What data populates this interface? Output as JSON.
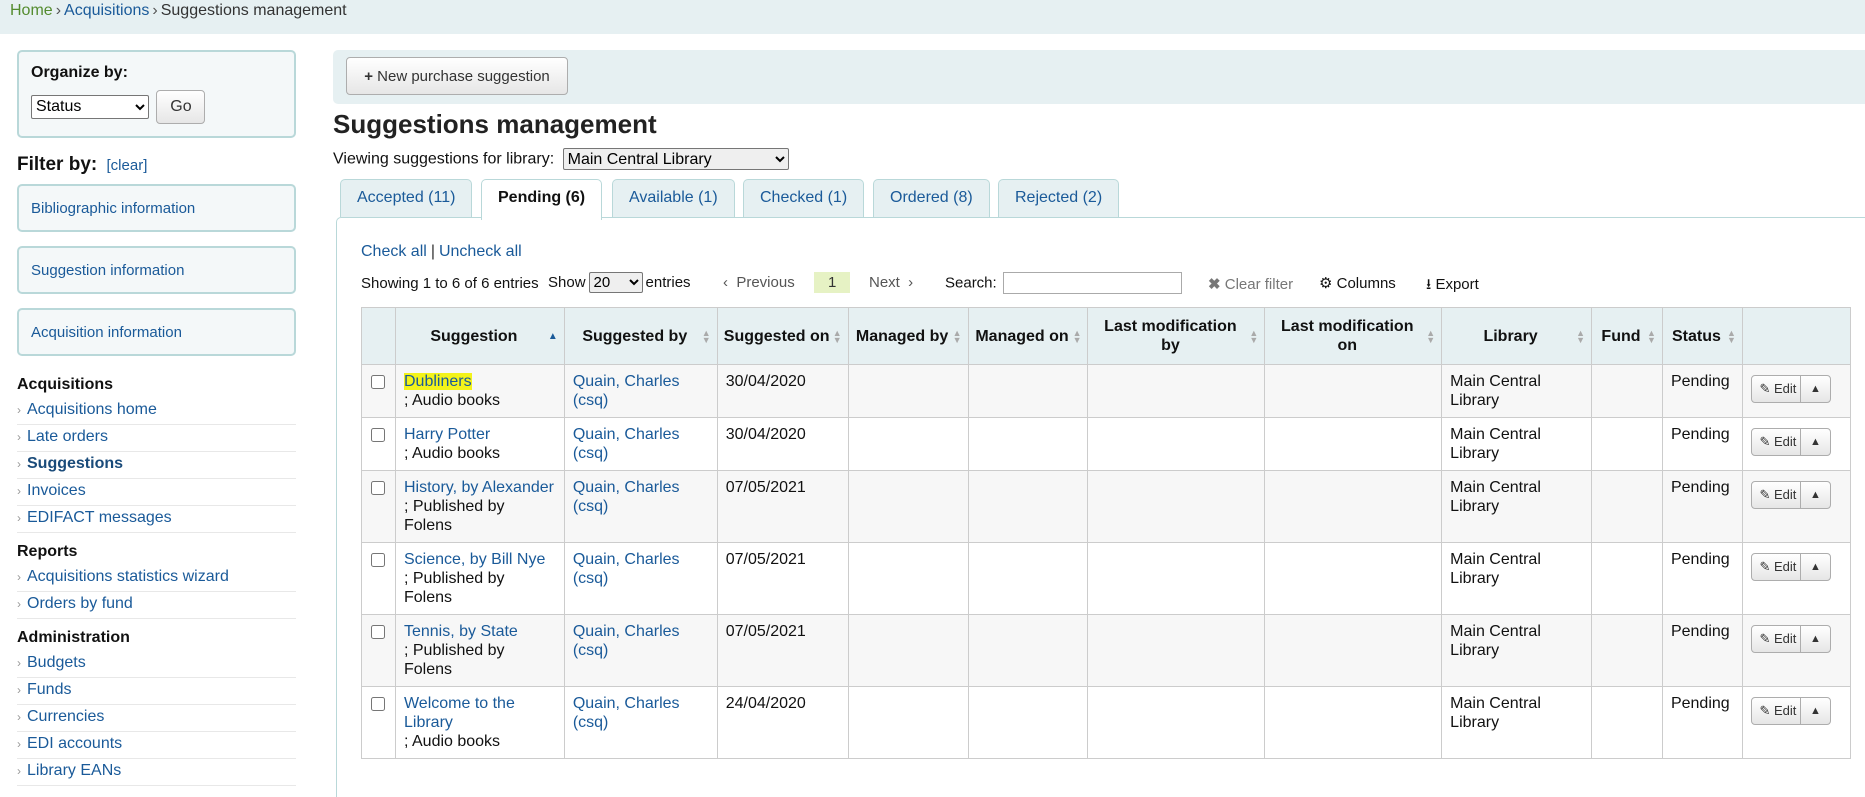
{
  "breadcrumb": {
    "home": "Home",
    "acquisitions": "Acquisitions",
    "current": "Suggestions management",
    "separator": "›"
  },
  "organize": {
    "label": "Organize by:",
    "selected": "Status",
    "go_label": "Go"
  },
  "filter": {
    "label": "Filter by:",
    "clear": "[clear]",
    "sections": [
      "Bibliographic information",
      "Suggestion information",
      "Acquisition information"
    ]
  },
  "nav": {
    "acquisitions": {
      "heading": "Acquisitions",
      "items": [
        "Acquisitions home",
        "Late orders",
        "Suggestions",
        "Invoices",
        "EDIFACT messages"
      ]
    },
    "reports": {
      "heading": "Reports",
      "items": [
        "Acquisitions statistics wizard",
        "Orders by fund"
      ]
    },
    "administration": {
      "heading": "Administration",
      "items": [
        "Budgets",
        "Funds",
        "Currencies",
        "EDI accounts",
        "Library EANs"
      ]
    }
  },
  "toolbar": {
    "new_label": "New purchase suggestion"
  },
  "page_title": "Suggestions management",
  "library_filter": {
    "label": "Viewing suggestions for library:",
    "selected": "Main Central Library"
  },
  "tabs": [
    "Accepted (11)",
    "Pending (6)",
    "Available (1)",
    "Checked (1)",
    "Ordered (8)",
    "Rejected (2)"
  ],
  "active_tab": "Pending (6)",
  "selection": {
    "check_all": "Check all",
    "uncheck_all": "Uncheck all",
    "separator": "|"
  },
  "table_info": {
    "showing": "Showing 1 to 6 of 6 entries",
    "show": "Show",
    "page_size": "20",
    "entries": "entries",
    "prev": "Previous",
    "current_page": "1",
    "next": "Next",
    "search_label": "Search:",
    "clear_filter": "Clear filter",
    "columns": "Columns",
    "export": "Export"
  },
  "columns": {
    "suggestion": "Suggestion",
    "suggested_by": "Suggested by",
    "suggested_on": "Suggested on",
    "managed_by": "Managed by",
    "managed_on": "Managed on",
    "last_mod_by": "Last modification by",
    "last_mod_on": "Last modification on",
    "library": "Library",
    "fund": "Fund",
    "status": "Status"
  },
  "rows": [
    {
      "title": "Dubliners",
      "sub": "; Audio books",
      "by": "Quain, Charles (csq)",
      "on": "30/04/2020",
      "library": "Main Central Library",
      "status": "Pending",
      "edit": "Edit",
      "highlight": true
    },
    {
      "title": "Harry Potter",
      "sub": "; Audio books",
      "by": "Quain, Charles (csq)",
      "on": "30/04/2020",
      "library": "Main Central Library",
      "status": "Pending",
      "edit": "Edit"
    },
    {
      "title": "History, by Alexander",
      "sub": "; Published by Folens",
      "by": "Quain, Charles (csq)",
      "on": "07/05/2021",
      "library": "Main Central Library",
      "status": "Pending",
      "edit": "Edit"
    },
    {
      "title": "Science, by Bill Nye",
      "sub": "; Published by Folens",
      "by": "Quain, Charles (csq)",
      "on": "07/05/2021",
      "library": "Main Central Library",
      "status": "Pending",
      "edit": "Edit"
    },
    {
      "title": "Tennis, by State",
      "sub": "; Published by Folens",
      "by": "Quain, Charles (csq)",
      "on": "07/05/2021",
      "library": "Main Central Library",
      "status": "Pending",
      "edit": "Edit"
    },
    {
      "title": "Welcome to the Library",
      "sub": "; Audio books",
      "by": "Quain, Charles (csq)",
      "on": "24/04/2020",
      "library": "Main Central Library",
      "status": "Pending",
      "edit": "Edit"
    }
  ]
}
